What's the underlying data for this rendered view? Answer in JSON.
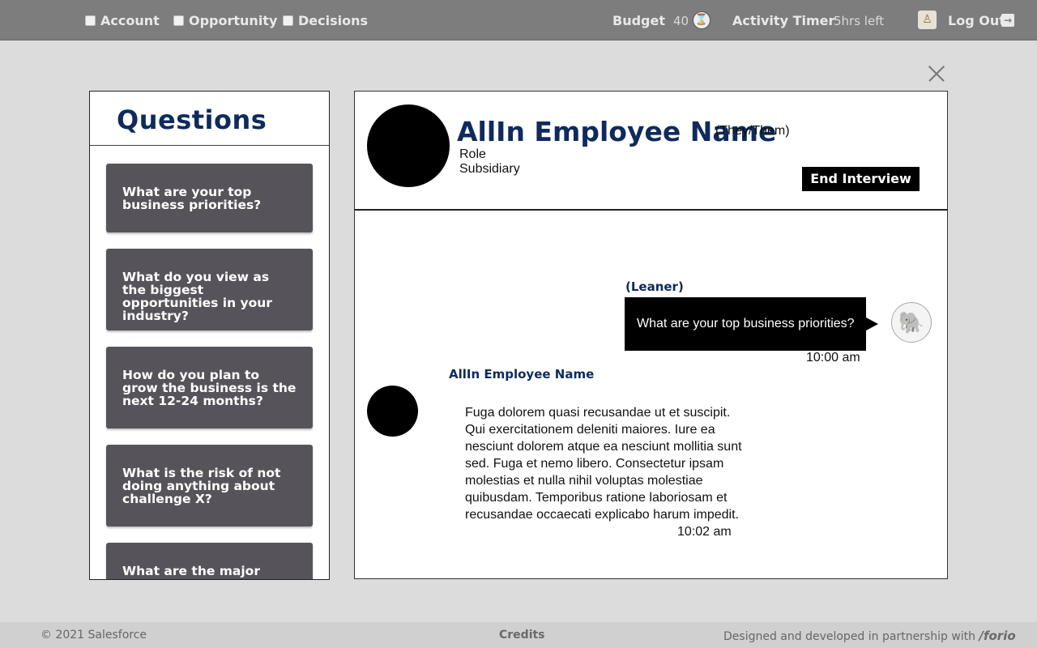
{
  "topbar": {
    "nav": [
      {
        "label": "Account"
      },
      {
        "label": "Opportunity"
      },
      {
        "label": "Decisions"
      }
    ],
    "budget_label": "Budget",
    "budget_value": "40",
    "timer_label": "Activity Timer",
    "timer_value": "5hrs left",
    "logout_label": "Log Out",
    "icons": {
      "budget": "hourglass-icon",
      "user": "user-avatar",
      "logout": "logout-arrow-icon",
      "close": "close-icon"
    }
  },
  "questions": {
    "title": "Questions",
    "items": [
      "What are your top business priorities?",
      "What do you view as the biggest opportunities in your industry?",
      "How do you plan to grow the business is the next 12-24 months?",
      "What is the risk of not doing anything about challenge X?",
      "What are the major"
    ]
  },
  "interview": {
    "employee_name": "AllIn Employee Name",
    "pronouns": "(They/Them)",
    "role": "Role",
    "subsidiary": "Subsidiary",
    "end_button": "End Interview",
    "messages": [
      {
        "sender": "(Leaner)",
        "text": "What are your top business priorities?",
        "time": "10:00 am"
      },
      {
        "sender": "AllIn Employee Name",
        "text": "Fuga dolorem quasi recusandae ut et suscipit. Qui exercitationem deleniti maiores. Iure ea nesciunt dolorem atque ea nesciunt mollitia sunt sed. Fuga et nemo libero. Consectetur ipsam molestias et nulla nihil voluptas molestiae quibusdam. Temporibus ratione laboriosam et recusandae occaecati explicabo harum impedit.",
        "time": "10:02 am"
      }
    ]
  },
  "footer": {
    "copyright": "© 2021 Salesforce",
    "credits": "Credits",
    "partner_text": "Designed and developed in partnership with",
    "partner_logo": "/forio"
  },
  "colors": {
    "navy": "#0f2b5c",
    "topbar": "#7d7d7d",
    "card": "#56545a"
  }
}
